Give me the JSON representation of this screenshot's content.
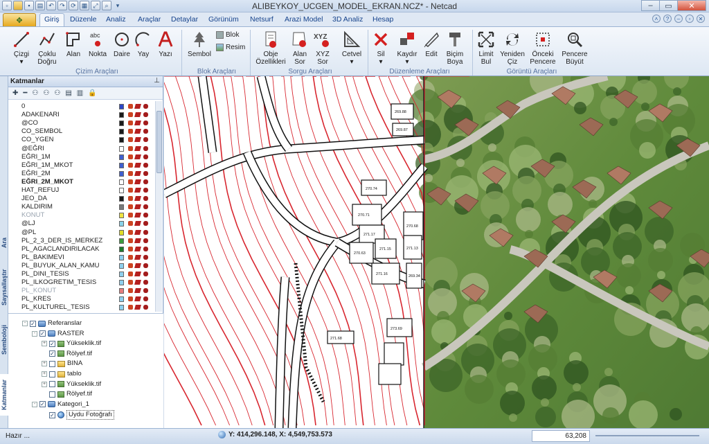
{
  "window": {
    "title": "ALIBEYKOY_UCGEN_MODEL_EKRAN.NCZ* - Netcad"
  },
  "tabs": [
    {
      "label": "Giriş",
      "active": true
    },
    {
      "label": "Düzenle"
    },
    {
      "label": "Analiz"
    },
    {
      "label": "Araçlar"
    },
    {
      "label": "Detaylar"
    },
    {
      "label": "Görünüm"
    },
    {
      "label": "Netsurf"
    },
    {
      "label": "Arazi Model"
    },
    {
      "label": "3D Analiz"
    },
    {
      "label": "Hesap"
    }
  ],
  "ribbon": {
    "groups": {
      "cizim": "Çizim Araçları",
      "blok": "Blok Araçları",
      "sorgu": "Sorgu Araçları",
      "duzenleme": "Düzenleme Araçları",
      "goruntu": "Görüntü Araçları"
    },
    "buttons": {
      "cizgi": "Çizgi",
      "coklu_dogru": "Çoklu Doğru",
      "alan": "Alan",
      "nokta": "Nokta",
      "daire": "Daire",
      "yay": "Yay",
      "yazi": "Yazı",
      "sembol": "Sembol",
      "blok": "Blok",
      "resim": "Resim",
      "obje_ozellikleri": "Obje Özellikleri",
      "alan_sor": "Alan Sor",
      "xyz_sor": "XYZ Sor",
      "cetvel": "Cetvel",
      "sil": "Sil",
      "kaydir": "Kaydır",
      "edit": "Edit",
      "bicim_boya": "Biçim Boya",
      "limit_bul": "Limit Bul",
      "yeniden_ciz": "Yeniden Çiz",
      "onceki_pencere": "Önceki Pencere",
      "pencere_buyut": "Pencere Büyüt"
    },
    "icon_text": {
      "nokta": "abc",
      "xyz_sor": "XYZ"
    }
  },
  "left_tabs": [
    "Ara",
    "Sayısallaştır",
    "Semboloji",
    "Katmanlar"
  ],
  "layers_panel": {
    "title": "Katmanlar",
    "layers": [
      {
        "name": "0",
        "color": "#2b46c6"
      },
      {
        "name": "ADAKENARI",
        "color": "#1a1a1a"
      },
      {
        "name": "@CO",
        "color": "#1a1a1a"
      },
      {
        "name": "CO_SEMBOL",
        "color": "#1a1a1a"
      },
      {
        "name": "CO_YGEN",
        "color": "#1a1a1a"
      },
      {
        "name": "@EĞRI",
        "color": "#ffffff"
      },
      {
        "name": "EĞRI_1M",
        "color": "#3f5fd0"
      },
      {
        "name": "EĞRI_1M_MKOT",
        "color": "#3f5fd0"
      },
      {
        "name": "EĞRI_2M",
        "color": "#3f5fd0"
      },
      {
        "name": "EĞRI_2M_MKOT",
        "color": "#ffffff",
        "bold": true
      },
      {
        "name": "HAT_REFUJ",
        "color": "#ffffff"
      },
      {
        "name": "JEO_DA",
        "color": "#1a1a1a"
      },
      {
        "name": "KALDIRIM",
        "color": "#7a7a7a"
      },
      {
        "name": "KONUT",
        "color": "#f0e442",
        "muted": true
      },
      {
        "name": "@LJ",
        "color": "#8ad3ea"
      },
      {
        "name": "@PL",
        "color": "#e0dc2a"
      },
      {
        "name": "PL_2_3_DER_IS_MERKEZ",
        "color": "#3c9b3e"
      },
      {
        "name": "PL_AGACLANDIRILACAK",
        "color": "#1f7a2c"
      },
      {
        "name": "PL_BAKIMEVI",
        "color": "#8fd0ee"
      },
      {
        "name": "PL_BUYUK_ALAN_KAMU",
        "color": "#8fd0ee"
      },
      {
        "name": "PL_DINI_TESIS",
        "color": "#8fd0ee"
      },
      {
        "name": "PL_ILKOGRETIM_TESIS",
        "color": "#8fd0ee"
      },
      {
        "name": "PL_KONUT",
        "color": "#e67e7e",
        "muted": true
      },
      {
        "name": "PL_KRES",
        "color": "#8fd0ee"
      },
      {
        "name": "PL_KULTUREL_TESIS",
        "color": "#8fd0ee"
      }
    ]
  },
  "reference_tree": [
    {
      "label": "Referanslar",
      "depth": 0,
      "icon": "db",
      "checked": true,
      "expander": "-"
    },
    {
      "label": "RASTER",
      "depth": 1,
      "icon": "db",
      "checked": true,
      "expander": "-"
    },
    {
      "label": "Yükseklik.tif",
      "depth": 2,
      "icon": "img",
      "checked": true,
      "expander": "+"
    },
    {
      "label": "Rölyef.tif",
      "depth": 2,
      "icon": "img",
      "checked": true,
      "expander": ""
    },
    {
      "label": "BINA",
      "depth": 2,
      "icon": "folder",
      "checked": false,
      "expander": "+"
    },
    {
      "label": "tablo",
      "depth": 2,
      "icon": "folder",
      "checked": false,
      "expander": "+"
    },
    {
      "label": "Yükseklik.tif",
      "depth": 2,
      "icon": "img",
      "checked": false,
      "expander": "+"
    },
    {
      "label": "Rölyef.tif",
      "depth": 2,
      "icon": "img",
      "checked": false,
      "expander": ""
    },
    {
      "label": "Kategori_1",
      "depth": 1,
      "icon": "db",
      "checked": true,
      "expander": "-"
    },
    {
      "label": "Uydu Fotoğrafı",
      "depth": 2,
      "icon": "globe",
      "checked": true,
      "expander": "",
      "selected": true
    }
  ],
  "map_labels": [
    "269.88",
    "269.87",
    "270.74",
    "270.71",
    "271.17",
    "270.63",
    "271.16",
    "271.15",
    "270.68",
    "271.13",
    "269.34",
    "273.69",
    "271.68"
  ],
  "status": {
    "ready": "Hazır ...",
    "coords": "Y: 414,296.148, X: 4,549,753.573",
    "zoom": "63,208"
  }
}
